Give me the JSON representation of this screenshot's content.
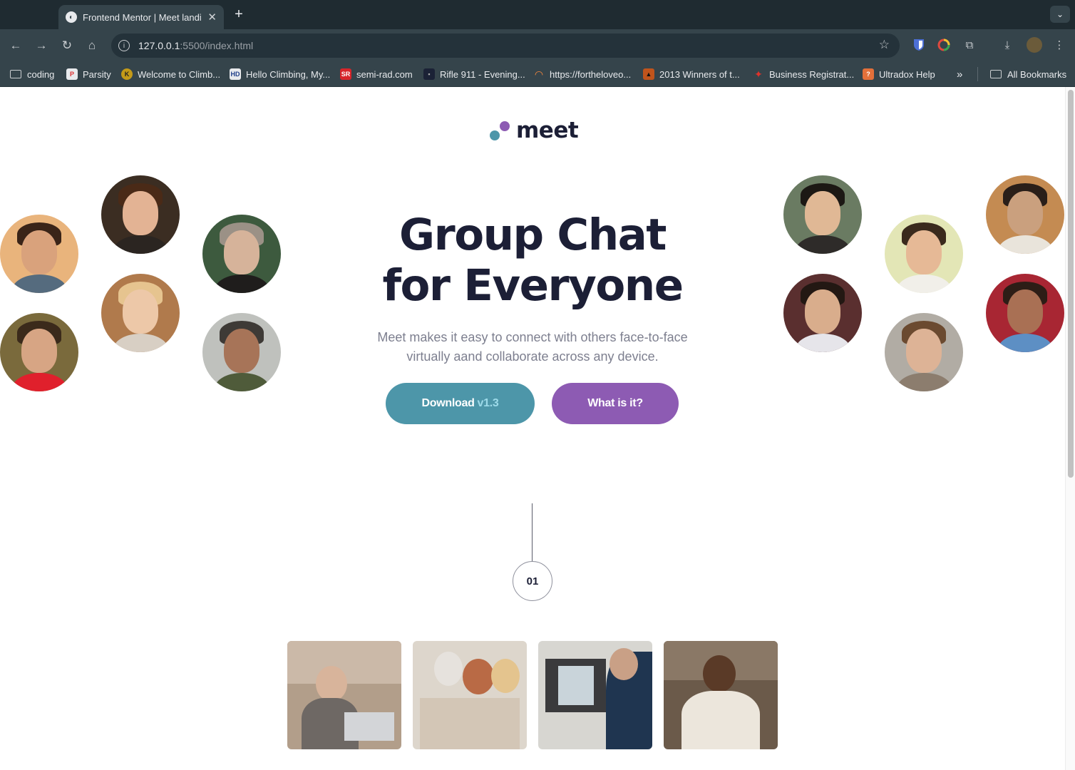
{
  "browser": {
    "tab_title": "Frontend Mentor | Meet landing page",
    "new_tab": "+",
    "url_host": "127.0.0.1",
    "url_path": ":5500/index.html",
    "bookmarks": [
      {
        "label": "coding",
        "icon": "folder-icon"
      },
      {
        "label": "Parsity",
        "icon": "parsity-icon"
      },
      {
        "label": "Welcome to Climb...",
        "icon": "climb-icon"
      },
      {
        "label": "Hello Climbing, My...",
        "icon": "hd-icon"
      },
      {
        "label": "semi-rad.com",
        "icon": "sr-icon"
      },
      {
        "label": "Rifle 911 - Evening...",
        "icon": "rifle-icon"
      },
      {
        "label": "https://fortheloveo...",
        "icon": "rainbow-icon"
      },
      {
        "label": "2013 Winners of t...",
        "icon": "mountain-icon"
      },
      {
        "label": "Business Registrat...",
        "icon": "maple-leaf-icon"
      },
      {
        "label": "Ultradox Help",
        "icon": "ultradox-icon"
      }
    ],
    "more_bookmarks": "»",
    "all_bookmarks": "All Bookmarks"
  },
  "page": {
    "logo_text": "meet",
    "headline_line1": "Group Chat",
    "headline_line2": "for Everyone",
    "subtext": "Meet makes it easy to connect with others face-to-face virtually aand collaborate across any device.",
    "download_label": "Download",
    "download_version": "v1.3",
    "what_label": "What is it?",
    "step_number": "01"
  },
  "colors": {
    "accent_teal": "#4d96a9",
    "accent_purple": "#8d5bb3",
    "heading": "#1c1f36",
    "body_text": "#7d7f8f"
  }
}
